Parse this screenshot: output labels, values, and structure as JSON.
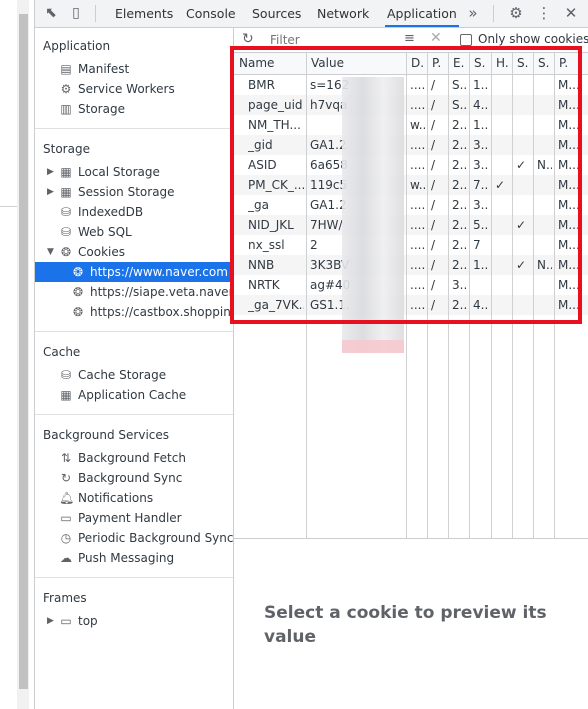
{
  "tabs": [
    "Elements",
    "Console",
    "Sources",
    "Network",
    "Application"
  ],
  "active_tab": "Application",
  "more_tabs": "»",
  "sidebar": {
    "application_title": "Application",
    "application_items": [
      {
        "label": "Manifest",
        "icon": "manifest-icon"
      },
      {
        "label": "Service Workers",
        "icon": "gear-icon"
      },
      {
        "label": "Storage",
        "icon": "storage-icon"
      }
    ],
    "storage_title": "Storage",
    "storage_items": [
      {
        "label": "Local Storage",
        "icon": "grid-icon"
      },
      {
        "label": "Session Storage",
        "icon": "grid-icon"
      },
      {
        "label": "IndexedDB",
        "icon": "database-icon"
      },
      {
        "label": "Web SQL",
        "icon": "database-icon"
      },
      {
        "label": "Cookies",
        "icon": "cookie-icon"
      }
    ],
    "cookie_sites": [
      "https://www.naver.com",
      "https://siape.veta.naver.com",
      "https://castbox.shopping.naver.com"
    ],
    "cache_title": "Cache",
    "cache_items": [
      {
        "label": "Cache Storage",
        "icon": "database-icon"
      },
      {
        "label": "Application Cache",
        "icon": "grid-icon"
      }
    ],
    "bg_title": "Background Services",
    "bg_items": [
      {
        "label": "Background Fetch",
        "icon": "updown-arrows-icon"
      },
      {
        "label": "Background Sync",
        "icon": "sync-icon"
      },
      {
        "label": "Notifications",
        "icon": "bell-icon"
      },
      {
        "label": "Payment Handler",
        "icon": "card-icon"
      },
      {
        "label": "Periodic Background Sync",
        "icon": "clock-icon"
      },
      {
        "label": "Push Messaging",
        "icon": "cloud-icon"
      }
    ],
    "frames_title": "Frames",
    "frames_items": [
      {
        "label": "top",
        "icon": "frame-icon"
      }
    ]
  },
  "toolbar": {
    "filter_placeholder": "Filter",
    "only_show_label": "Only show cookies w"
  },
  "table": {
    "columns": [
      "Name",
      "Value",
      "D.",
      "P.",
      "E.",
      "S.",
      "H.",
      "S.",
      "S.",
      "P."
    ],
    "rows": [
      [
        "BMR",
        "s=162",
        "....",
        "/",
        "S...",
        "1...",
        "",
        "",
        "",
        "M..."
      ],
      [
        "page_uid",
        "h7vqa",
        "....",
        "/",
        "S...",
        "4...",
        "",
        "",
        "",
        "M..."
      ],
      [
        "NM_TH...",
        "",
        "w...",
        "/",
        "2...",
        "1...",
        "",
        "",
        "",
        "M..."
      ],
      [
        "_gid",
        "GA1.2",
        "....",
        "/",
        "2...",
        "3...",
        "",
        "",
        "",
        "M..."
      ],
      [
        "ASID",
        "6a658",
        "....",
        "/",
        "2...",
        "3...",
        "",
        "✓",
        "N...",
        "M..."
      ],
      [
        "PM_CK_...",
        "119c5",
        "w...",
        "/",
        "2...",
        "7...",
        "✓",
        "",
        "",
        "M..."
      ],
      [
        "_ga",
        "GA1.2",
        "....",
        "/",
        "2...",
        "3...",
        "",
        "",
        "",
        "M..."
      ],
      [
        "NID_JKL",
        "7HW/",
        "....",
        "/",
        "2...",
        "5...",
        "",
        "✓",
        "",
        "M..."
      ],
      [
        "nx_ssl",
        "2",
        "....",
        "/",
        "2...",
        "7",
        "",
        "",
        "",
        "M..."
      ],
      [
        "NNB",
        "3K3BV",
        "....",
        "/",
        "2...",
        "1...",
        "",
        "✓",
        "N...",
        "M..."
      ],
      [
        "NRTK",
        "ag#40",
        "....",
        "/",
        "3...",
        "",
        "",
        "",
        "",
        "M..."
      ],
      [
        "_ga_7VK...",
        "GS1.1.",
        "....",
        "/",
        "2...",
        "4...",
        "",
        "",
        "",
        "M..."
      ]
    ]
  },
  "preview_message": "Select a cookie to preview its value",
  "colors": {
    "accent": "#1a73e8",
    "highlight_box": "#e8101f"
  }
}
